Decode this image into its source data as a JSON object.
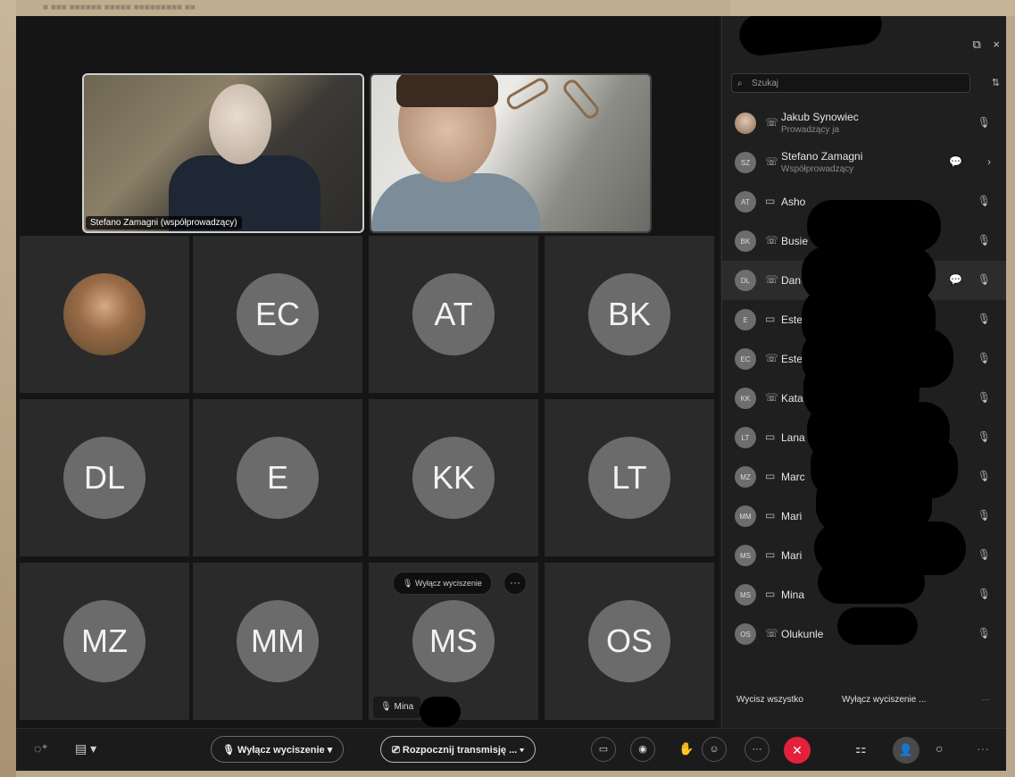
{
  "window": {
    "title_strip": "■ ■■■ ■■■■■■ ■■■■■ ■■■■■■■■■ ■■"
  },
  "panel": {
    "close_icon": "×",
    "popout_icon": "⧉",
    "search_placeholder": "Szukaj",
    "footer": {
      "mute_all": "Wycisz wszystko",
      "unmute": "Wyłącz wyciszenie ..."
    },
    "participants": [
      {
        "initials": "",
        "name": "Jakub Synowiec",
        "role": "Prowadzący ja",
        "status": "phone",
        "chat": false
      },
      {
        "initials": "SZ",
        "name": "Stefano Zamagni",
        "role": "Współprowadzący",
        "status": "phone",
        "chat": true
      },
      {
        "initials": "AT",
        "name": "Asho",
        "role": "",
        "status": "screen",
        "chat": false
      },
      {
        "initials": "BK",
        "name": "Busie",
        "role": "",
        "status": "phone",
        "chat": false
      },
      {
        "initials": "DL",
        "name": "Dan",
        "role": "",
        "status": "phone",
        "chat": true
      },
      {
        "initials": "E",
        "name": "Este",
        "role": "",
        "status": "screen",
        "chat": false
      },
      {
        "initials": "EC",
        "name": "Este",
        "role": "",
        "status": "phone",
        "chat": false
      },
      {
        "initials": "KK",
        "name": "Kata",
        "role": "",
        "status": "phone",
        "chat": false
      },
      {
        "initials": "LT",
        "name": "Lana T",
        "role": "",
        "status": "screen",
        "chat": false
      },
      {
        "initials": "MZ",
        "name": "Marc",
        "role": "",
        "status": "screen",
        "chat": false
      },
      {
        "initials": "MM",
        "name": "Mari",
        "role": "",
        "status": "screen",
        "chat": false
      },
      {
        "initials": "MS",
        "name": "Mari",
        "role": "",
        "status": "screen",
        "chat": true
      },
      {
        "initials": "MS",
        "name": "Mina",
        "role": "",
        "status": "screen",
        "chat": false
      },
      {
        "initials": "OS",
        "name": "Olukunle",
        "role": "",
        "status": "phone",
        "chat": false
      }
    ]
  },
  "videos": {
    "v1_label": "Stefano Zamagni (współprowadzący)"
  },
  "grid": {
    "tiles": [
      "",
      "EC",
      "AT",
      "BK",
      "DL",
      "E",
      "KK",
      "LT",
      "MZ",
      "MM",
      "MS",
      "OS"
    ],
    "hover_unmute": "Wyłącz wyciszenie",
    "hover_more": "···",
    "tile_name": "Mina"
  },
  "toolbar": {
    "unmute_label": "Wyłącz wyciszenie",
    "stream_label": "Rozpocznij transmisję ...",
    "end_icon": "✕",
    "more_icon": "···"
  },
  "colors": {
    "end_call": "#e3213b",
    "avatar": "#6b6b6b",
    "background": "#151515"
  }
}
